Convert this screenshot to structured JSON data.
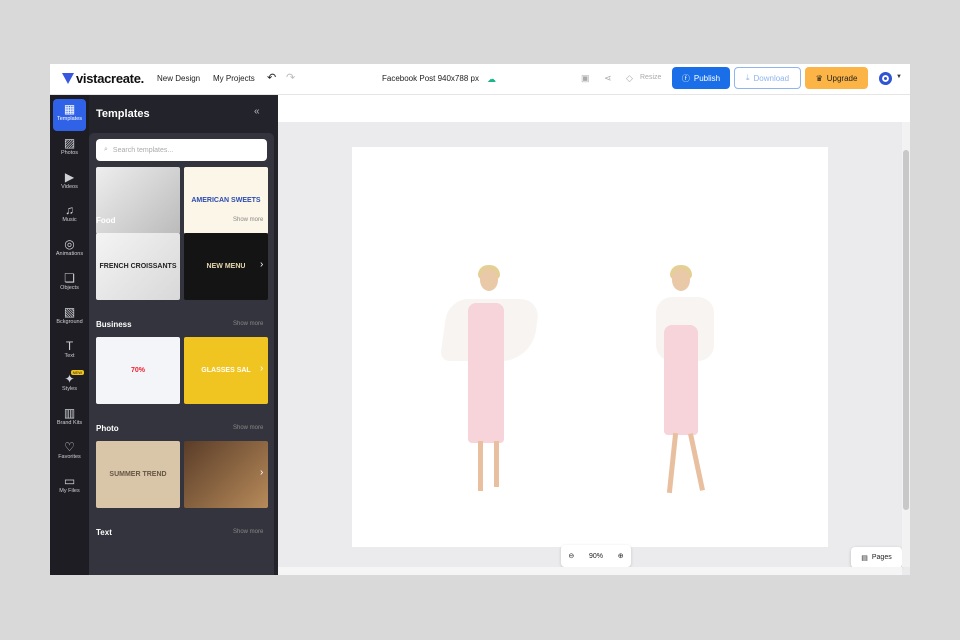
{
  "header": {
    "brand": "vistacreate.",
    "nav": [
      "New Design",
      "My Projects"
    ],
    "doc_title": "Facebook Post 940x788 px",
    "resize": "Resize",
    "publish": "Publish",
    "download": "Download",
    "upgrade": "Upgrade",
    "accent": "#1a6fe8",
    "upgrade_color": "#fcb446"
  },
  "rail": [
    {
      "label": "Templates",
      "icon": "grid"
    },
    {
      "label": "Photos",
      "icon": "image"
    },
    {
      "label": "Videos",
      "icon": "play"
    },
    {
      "label": "Music",
      "icon": "note"
    },
    {
      "label": "Animations",
      "icon": "animation"
    },
    {
      "label": "Objects",
      "icon": "shapes"
    },
    {
      "label": "Bckground",
      "icon": "stripes"
    },
    {
      "label": "Text",
      "icon": "text"
    },
    {
      "label": "Styles",
      "icon": "sparkle",
      "badge": "NEW"
    },
    {
      "label": "Brand Kits",
      "icon": "briefcase"
    },
    {
      "label": "Favorites",
      "icon": "heart"
    },
    {
      "label": "My Files",
      "icon": "folder"
    }
  ],
  "panel": {
    "title": "Templates",
    "search_placeholder": "Search templates...",
    "sections": [
      {
        "name": "Food",
        "more": "Show more",
        "thumbs": [
          "FRENCH CROISSANTS",
          "NEW MENU"
        ]
      },
      {
        "name": "Business",
        "more": "Show more",
        "thumbs": [
          "70%",
          "GLASSES SAL"
        ]
      },
      {
        "name": "Photo",
        "more": "Show more",
        "thumbs": [
          "SUMMER TREND",
          ""
        ]
      },
      {
        "name": "Text",
        "more": "Show more"
      }
    ],
    "top_thumbs": [
      "",
      "AMERICAN SWEETS"
    ]
  },
  "canvas": {
    "zoom": "90%",
    "pages": "Pages"
  }
}
